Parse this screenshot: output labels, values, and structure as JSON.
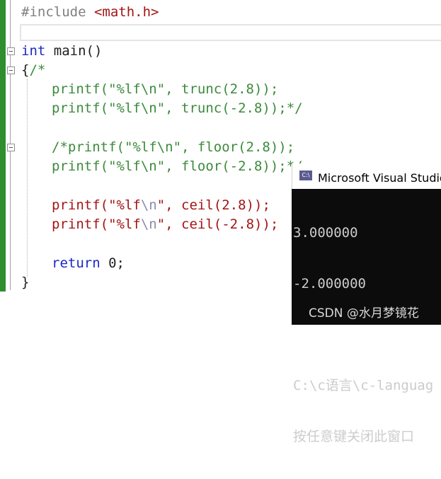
{
  "editor": {
    "lines": {
      "l1": "#include",
      "l1_header": "<math.h>",
      "l3_kw": "int",
      "l3_rest": " main()",
      "l4_brace": "{",
      "l4_cmt": "/*",
      "l5": "printf(\"%lf\\n\", trunc(2.8));",
      "l6": "printf(\"%lf\\n\", trunc(-2.8));*/",
      "l8": "/*printf(\"%lf\\n\", floor(2.8));",
      "l9": "printf(\"%lf\\n\", floor(-2.8));*/",
      "l11_a": "printf(\"%lf",
      "l11_esc": "\\n",
      "l11_b": "\", ceil(2.8));",
      "l12_a": "printf(\"%lf",
      "l12_esc": "\\n",
      "l12_b": "\", ceil(-2.8));",
      "l14_kw": "return",
      "l14_rest": " 0;",
      "l15": "}"
    }
  },
  "console": {
    "icon_text": "C:\\",
    "title": "Microsoft Visual Studio 调",
    "output": [
      "3.000000",
      "-2.000000",
      "",
      "C:\\c语言\\c-languag",
      "按任意键关闭此窗口"
    ]
  },
  "watermark": "CSDN @水月梦镜花",
  "colors": {
    "keyword": "#1a28c7",
    "comment": "#3c8a3c",
    "string": "#a31515",
    "gutter_bar": "#2d8f2d",
    "console_bg": "#0c0c0c"
  }
}
